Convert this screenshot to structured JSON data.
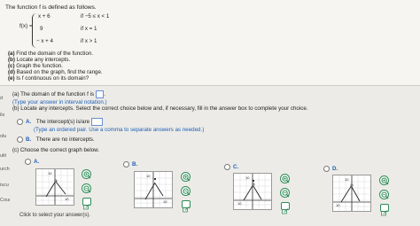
{
  "problem": {
    "intro": "The function f is defined as follows.",
    "fx_label": "f(x) =",
    "cases": [
      {
        "expr": "x + 6",
        "cond": "if  −5 ≤ x < 1"
      },
      {
        "expr": "9",
        "cond": "if x = 1"
      },
      {
        "expr": "− x + 4",
        "cond": "if x > 1"
      }
    ],
    "questions": [
      {
        "id": "(a)",
        "text": "Find the domain of the function."
      },
      {
        "id": "(b)",
        "text": "Locate any intercepts."
      },
      {
        "id": "(c)",
        "text": "Graph the function."
      },
      {
        "id": "(d)",
        "text": "Based on the graph, find the range."
      },
      {
        "id": "(e)",
        "text": "Is f continuous on its domain?"
      }
    ]
  },
  "answers": {
    "a_text": "(a) The domain of the function f is",
    "a_hint": "(Type your answer in interval notation.)",
    "b_text": "(b) Locate any intercepts. Select the correct choice below and, if necessary, fill in the answer box to complete your choice.",
    "option_a_label": "A.",
    "option_a_text": "The intercept(s) is/are",
    "option_a_hint": "(Type an ordered pair. Use a comma to separate answers as needed.)",
    "option_b_label": "B.",
    "option_b_text": "There are no intercepts.",
    "c_text": "(c) Choose the correct graph below."
  },
  "graph_choices": [
    {
      "label": "A.",
      "y_tick": "10",
      "x_tick": "10"
    },
    {
      "label": "B.",
      "y_tick": "10",
      "x_tick": "10"
    },
    {
      "label": "C.",
      "y_tick": "10",
      "x_tick": "10"
    },
    {
      "label": "D.",
      "y_tick": "10",
      "x_tick": "10"
    }
  ],
  "side_tabs": [
    "d",
    "ils",
    "olu",
    "ulti",
    "urch",
    "iscu",
    "Cour"
  ],
  "footer": "Click to select your answer(s).",
  "icons": {
    "zoom_in": "zoom-in-icon",
    "zoom_out": "zoom-out-icon",
    "popout": "popout-icon"
  }
}
